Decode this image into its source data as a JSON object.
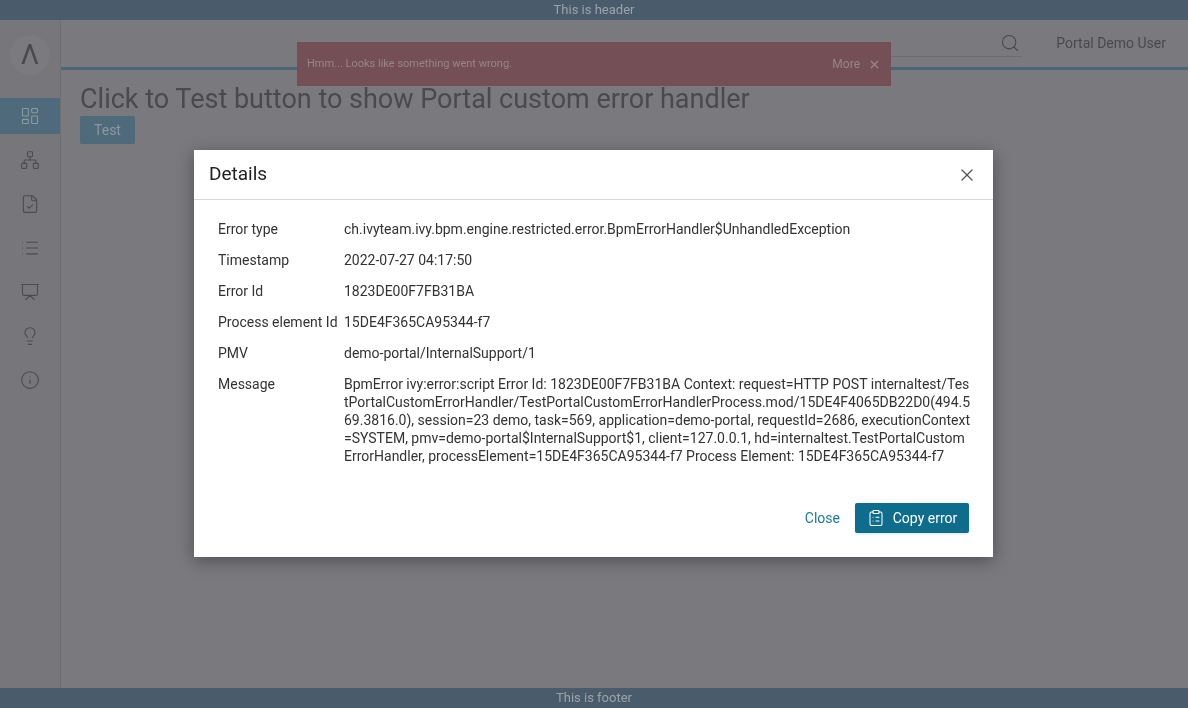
{
  "header": {
    "text": "This is header"
  },
  "sidebar": {
    "logo": "Λ",
    "items": [
      {
        "selected": true
      },
      {
        "selected": false
      },
      {
        "selected": false
      },
      {
        "selected": false
      },
      {
        "selected": false
      },
      {
        "selected": false
      },
      {
        "selected": false
      }
    ]
  },
  "topbar": {
    "user": "Portal Demo User"
  },
  "page": {
    "heading": "Click to Test button to show Portal custom error handler",
    "button": "Test"
  },
  "toast": {
    "message": "Hmm... Looks like something went wrong.",
    "more": "More"
  },
  "dialog": {
    "title": "Details",
    "rows": [
      {
        "label": "Error type",
        "value": "ch.ivyteam.ivy.bpm.engine.restricted.error.BpmErrorHandler$UnhandledException"
      },
      {
        "label": "Timestamp",
        "value": "2022-07-27 04:17:50"
      },
      {
        "label": "Error Id",
        "value": "1823DE00F7FB31BA"
      },
      {
        "label": "Process element Id",
        "value": "15DE4F365CA95344-f7"
      },
      {
        "label": "PMV",
        "value": "demo-portal/InternalSupport/1"
      },
      {
        "label": "Message",
        "value": "BpmError ivy:error:script Error Id: 1823DE00F7FB31BA Context: request=HTTP POST internaltest/TestPortalCustomErrorHandler/TestPortalCustomErrorHandlerProcess.mod/15DE4F4065DB22D0(494.569.3816.0), session=23 demo, task=569, application=demo-portal, requestId=2686, executionContext=SYSTEM, pmv=demo-portal$InternalSupport$1, client=127.0.0.1, hd=internaltest.TestPortalCustomErrorHandler, processElement=15DE4F365CA95344-f7 Process Element: 15DE4F365CA95344-f7"
      }
    ],
    "close": "Close",
    "copy": "Copy error"
  },
  "footer": {
    "text": "This is footer"
  }
}
